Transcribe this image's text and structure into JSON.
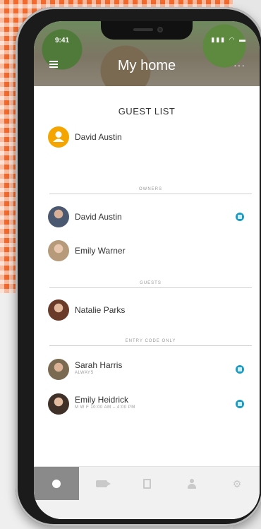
{
  "status": {
    "time": "9:41",
    "icons": "▮▮▮ ◠ ▬"
  },
  "header": {
    "title": "My home",
    "more": "···"
  },
  "guest_list": {
    "title": "GUEST LIST",
    "primary": {
      "name": "David Austin"
    },
    "owners_label": "OWNERS",
    "owners": [
      {
        "name": "David Austin"
      },
      {
        "name": "Emily Warner"
      }
    ],
    "guests_label": "GUESTS",
    "guests": [
      {
        "name": "Natalie Parks"
      }
    ],
    "entry_label": "ENTRY CODE ONLY",
    "entry": [
      {
        "name": "Sarah Harris",
        "schedule": "ALWAYS"
      },
      {
        "name": "Emily Heidrick",
        "schedule": "M W F 10:00 AM – 4:00 PM"
      }
    ]
  },
  "colors": {
    "accent": "#1a9bc4",
    "primary_avatar": "#f5a500"
  },
  "tabs": [
    {
      "icon": "home-dot-icon"
    },
    {
      "icon": "video-camera-icon"
    },
    {
      "icon": "history-icon"
    },
    {
      "icon": "guest-list-icon"
    },
    {
      "icon": "gear-icon"
    }
  ]
}
